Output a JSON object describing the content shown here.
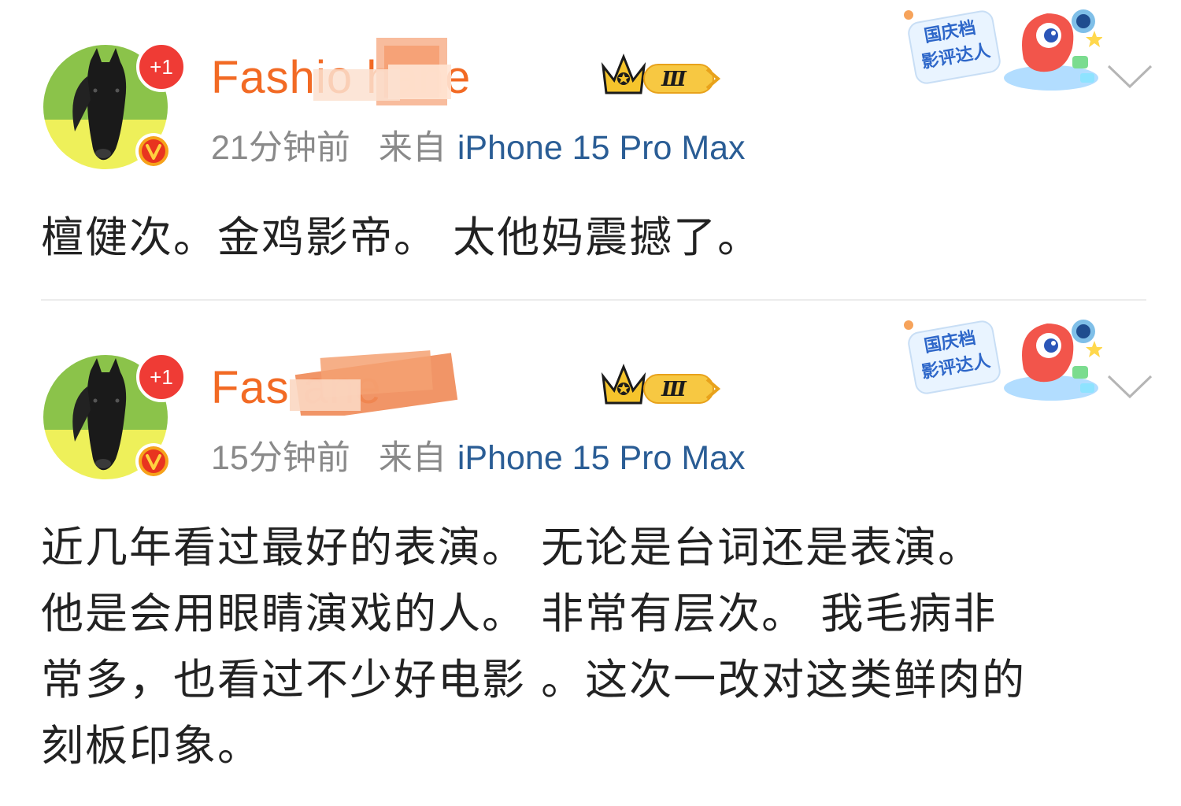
{
  "posts": [
    {
      "badge_count": "+1",
      "username": "Fashio   hane",
      "level_badge": "Ⅲ",
      "timestamp": "21分钟前",
      "source_prefix": "来自",
      "device": "iPhone 15 Pro Max",
      "event_badge_text": [
        "国庆档",
        "影评达人"
      ],
      "content": "檀健次。金鸡影帝。 太他妈震撼了。"
    },
    {
      "badge_count": "+1",
      "username": "Fas          ane",
      "level_badge": "Ⅲ",
      "timestamp": "15分钟前",
      "source_prefix": "来自",
      "device": "iPhone 15 Pro Max",
      "event_badge_text": [
        "国庆档",
        "影评达人"
      ],
      "content": "近几年看过最好的表演。 无论是台词还是表演。\n他是会用眼睛演戏的人。 非常有层次。 我毛病非\n常多，也看过不少好电影 。这次一改对这类鲜肉的\n刻板印象。"
    }
  ],
  "colors": {
    "username": "#f26a24",
    "device_link": "#2a5d95",
    "meta_gray": "#8a8a8a",
    "badge_red": "#ef3b35",
    "crown_gold": "#f5c42c"
  },
  "icons": {
    "chevron": "chevron-down-icon",
    "verified": "verified-badge-icon",
    "crown": "crown-icon"
  }
}
